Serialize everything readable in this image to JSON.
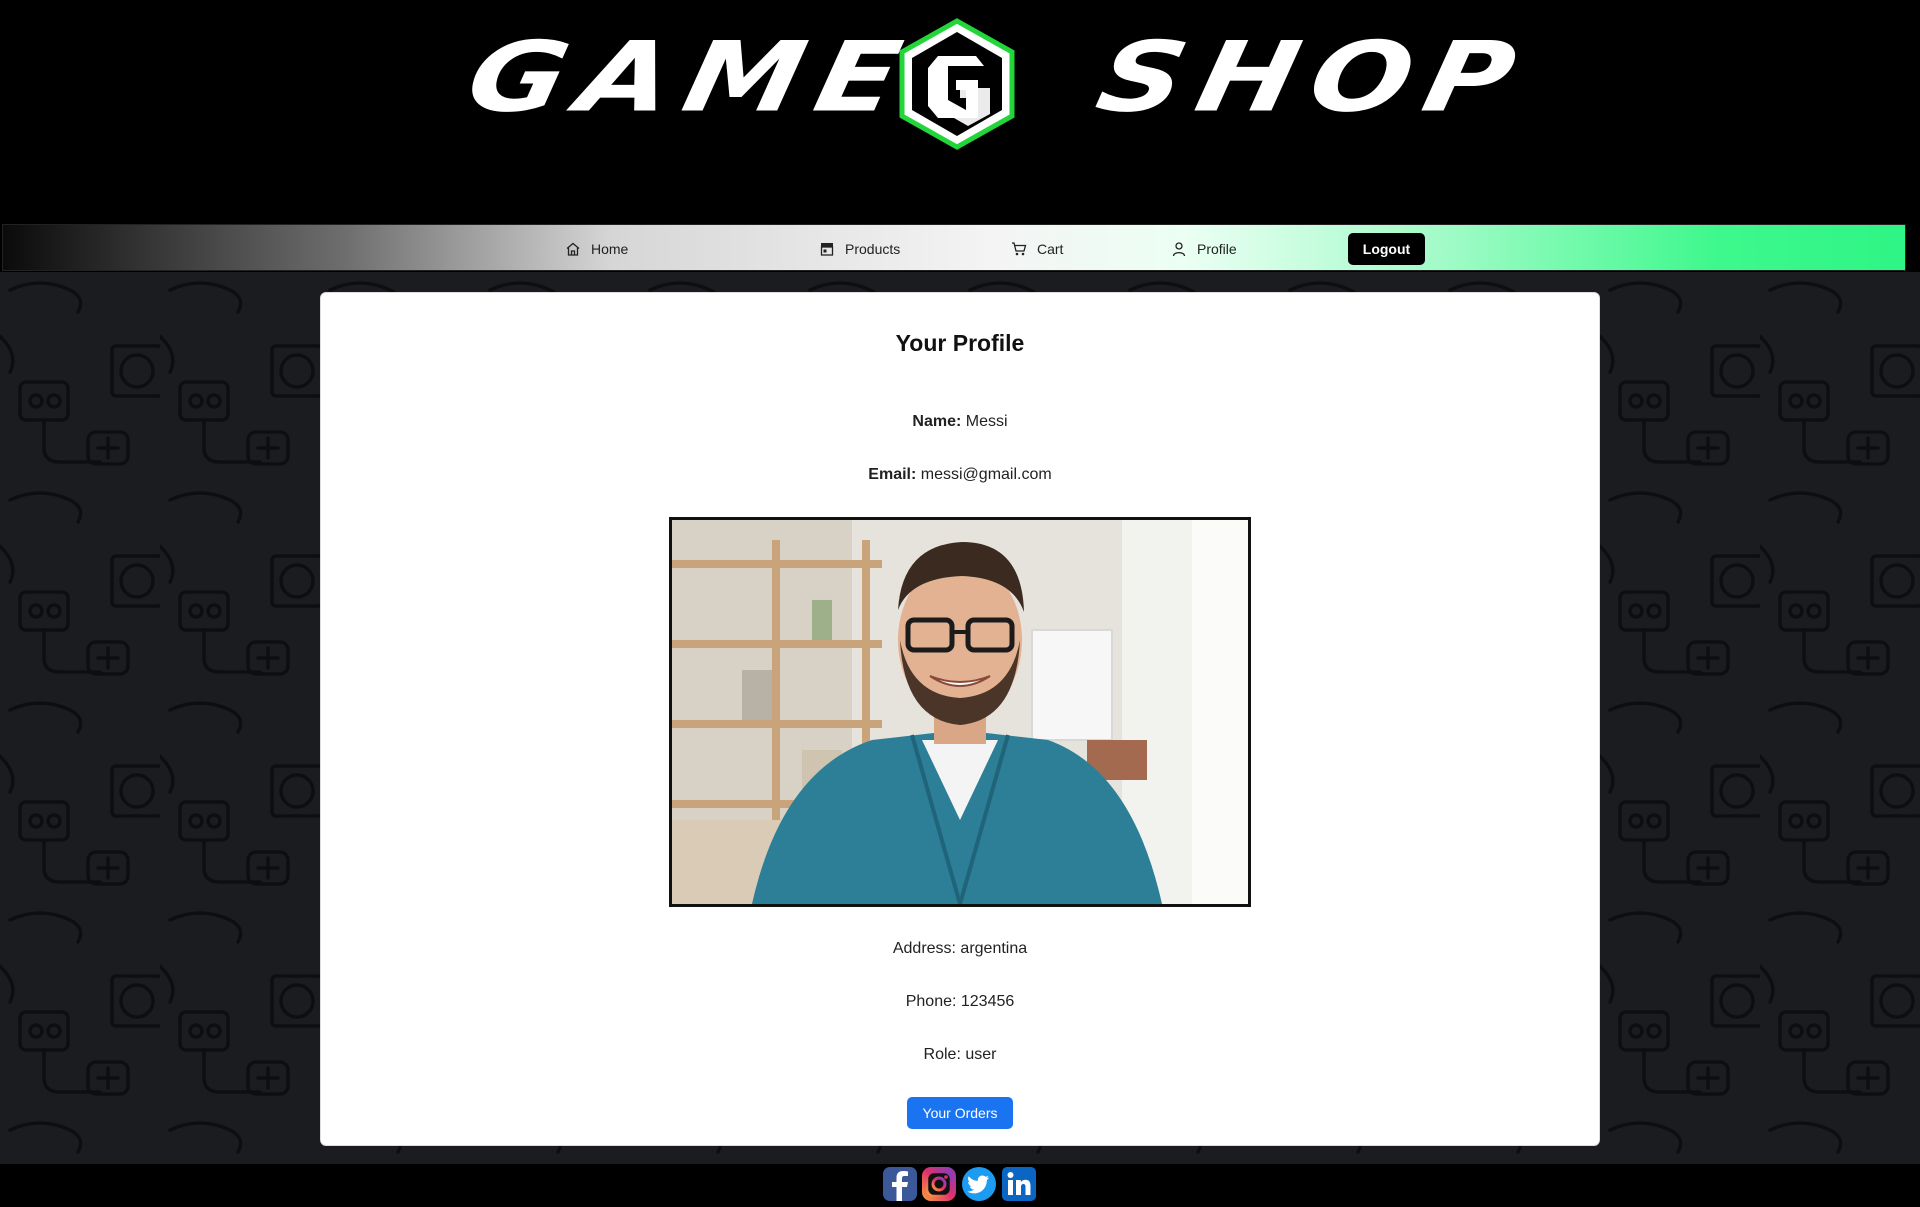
{
  "brand": {
    "word_left": "GAME",
    "word_right": "SHOP",
    "emblem_icon": "gs-hexagon-logo-icon",
    "accent": "#22d63a"
  },
  "nav": {
    "items": [
      {
        "label": "Home",
        "icon": "home-icon"
      },
      {
        "label": "Products",
        "icon": "store-icon"
      },
      {
        "label": "Cart",
        "icon": "cart-icon"
      },
      {
        "label": "Profile",
        "icon": "user-icon"
      }
    ],
    "logout_label": "Logout"
  },
  "profile": {
    "title": "Your Profile",
    "name_label": "Name:",
    "name_value": "Messi",
    "email_label": "Email:",
    "email_value": "messi@gmail.com",
    "address_line": "Address: argentina",
    "phone_line": "Phone: 123456",
    "role_line": "Role: user",
    "orders_button": "Your Orders"
  },
  "footer": {
    "social": [
      "facebook-icon",
      "instagram-icon",
      "twitter-icon",
      "linkedin-icon"
    ]
  },
  "colors": {
    "orders_button": "#1a73f0",
    "nav_gradient_end": "#2ef585",
    "page_background": "#1b1c1f"
  }
}
